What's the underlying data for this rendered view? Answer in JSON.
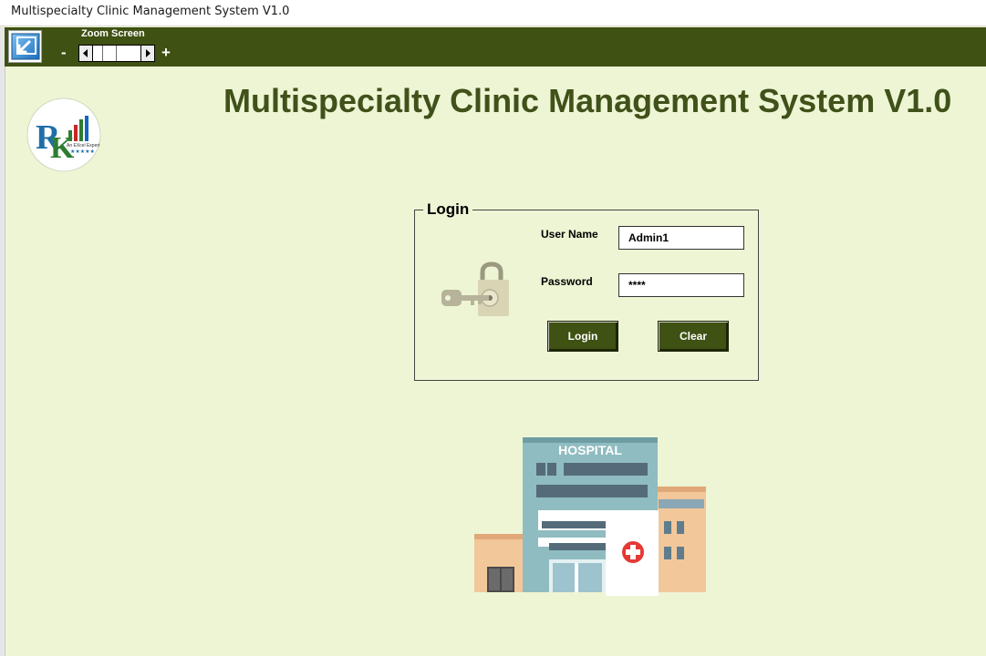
{
  "window": {
    "title": "Multispecialty Clinic Management System V1.0"
  },
  "toolbar": {
    "back_icon": "arrow-back-icon",
    "zoom_label": "Zoom Screen",
    "zoom_minus": "-",
    "zoom_plus": "+"
  },
  "header": {
    "app_title": "Multispecialty Clinic Management System V1.0"
  },
  "logo": {
    "text_letters": "RK",
    "tagline": "An EXcel Expert",
    "icon": "rk-logo"
  },
  "login": {
    "legend": "Login",
    "username_label": "User Name",
    "username_value": "Admin1",
    "password_label": "Password",
    "password_value": "****",
    "login_button": "Login",
    "clear_button": "Clear",
    "lock_icon": "lock-key-icon"
  },
  "illustration": {
    "sign_text": "HOSPITAL",
    "icon": "hospital-building-icon"
  },
  "colors": {
    "background": "#eef5d4",
    "toolbar": "#3f5113",
    "title_text": "#40511a",
    "button": "#3f5113"
  }
}
